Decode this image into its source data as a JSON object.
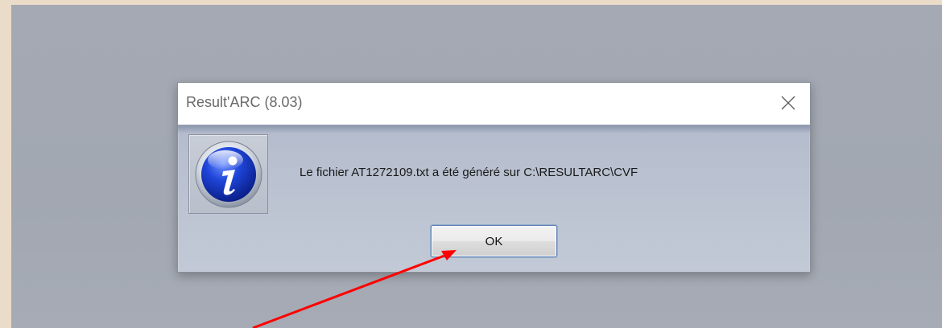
{
  "dialog": {
    "title": "Result'ARC (8.03)",
    "message": "Le fichier AT1272109.txt a été généré sur C:\\RESULTARC\\CVF",
    "ok_label": "OK",
    "icon": "information-icon",
    "close_icon": "close-icon"
  },
  "annotation": {
    "arrow_color": "#ff0000"
  }
}
